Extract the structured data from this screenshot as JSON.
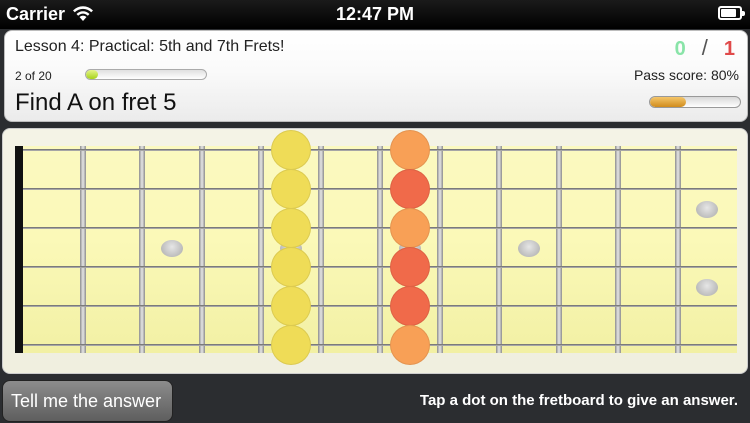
{
  "status_bar": {
    "carrier": "Carrier",
    "time": "12:47 PM",
    "icons": [
      "wifi-icon",
      "battery-icon"
    ]
  },
  "header": {
    "lesson_title": "Lesson 4: Practical: 5th and 7th Frets!",
    "score_correct": "0",
    "score_separator": "/",
    "score_wrong": "1",
    "progress_text": "2 of 20",
    "progress_fraction": 0.1,
    "pass_score_text": "Pass score: 80%",
    "question": "Find A on fret 5",
    "pass_meter_fraction": 0.4
  },
  "fretboard": {
    "strings": 6,
    "frets": 12,
    "fret5_dots": [
      "#efdc57",
      "#efdc57",
      "#efdc57",
      "#efdc57",
      "#efdc57",
      "#efdc57"
    ],
    "fret7_dots": [
      "#f8a056",
      "#f06a4a",
      "#f8a056",
      "#f06a4a",
      "#f06a4a",
      "#f8a056"
    ]
  },
  "footer": {
    "answer_button": "Tell me the answer",
    "hint": "Tap a dot on the fretboard to give an answer."
  },
  "colors": {
    "correct": "#89e4a8",
    "wrong": "#e04a4a",
    "progress": "#a6d21a",
    "pass_meter": "#d08c1c"
  }
}
